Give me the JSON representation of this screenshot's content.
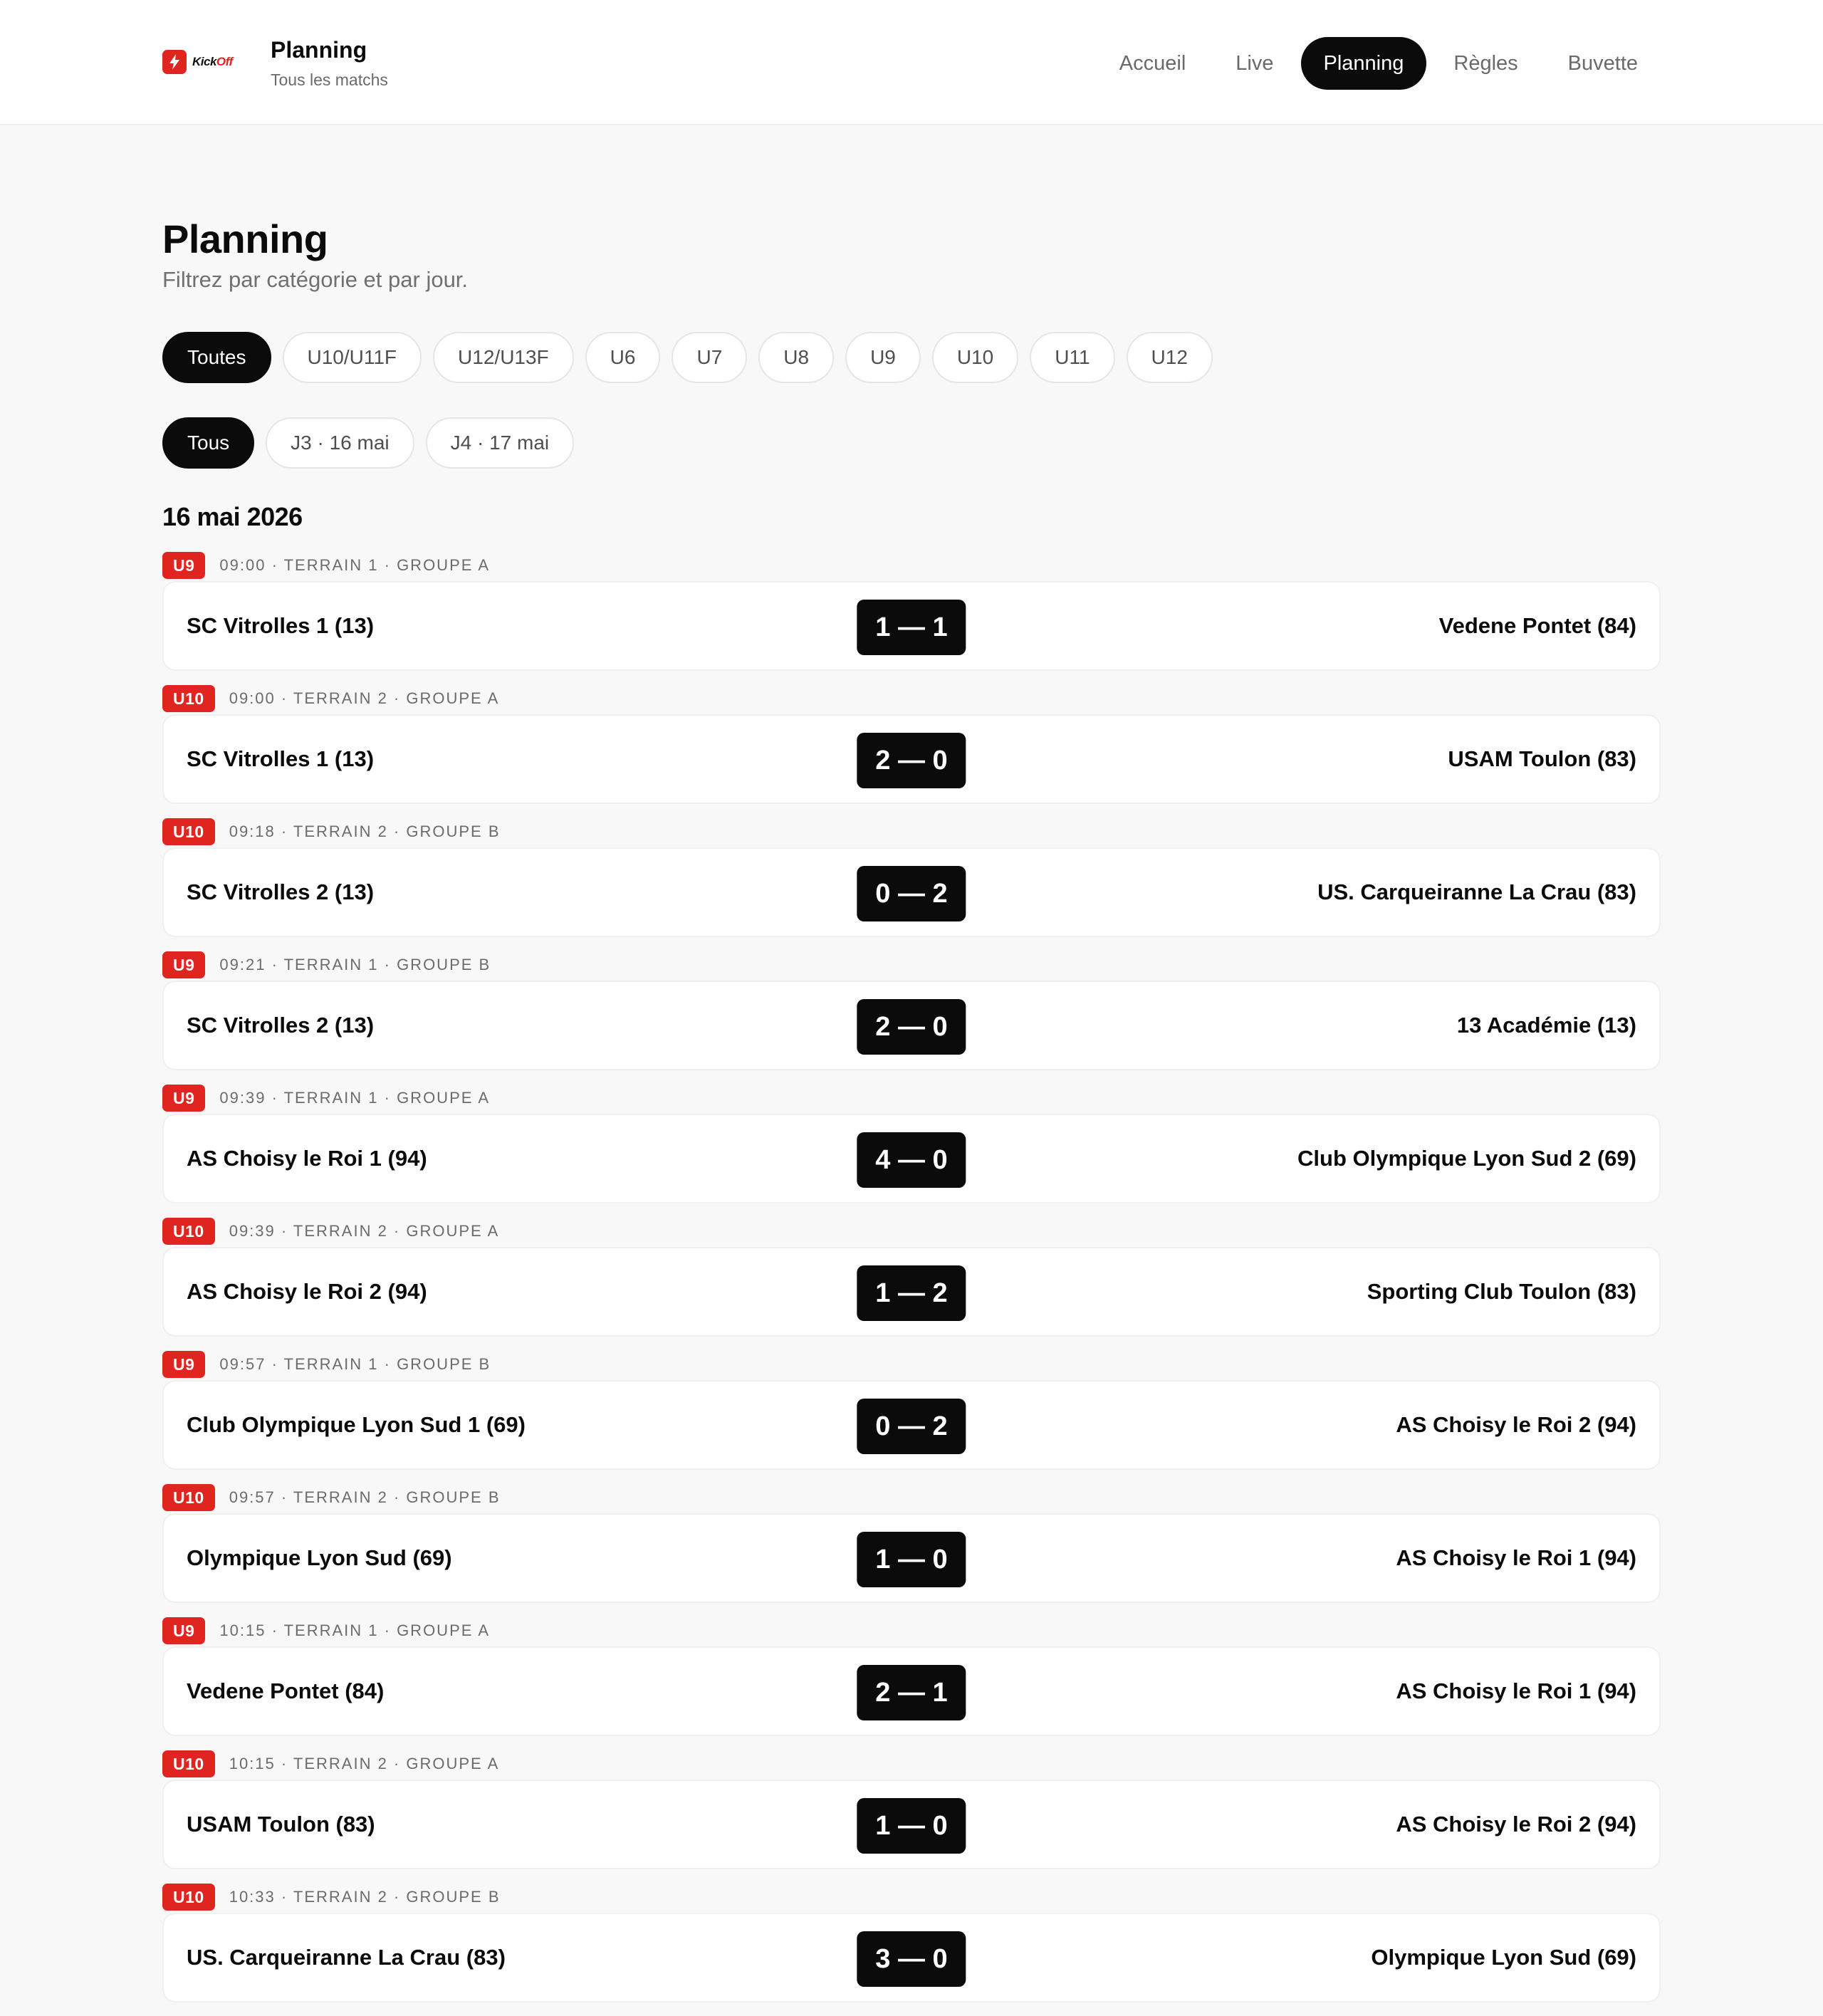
{
  "header": {
    "logo_text_a": "Kick",
    "logo_text_b": "Off",
    "title": "Planning",
    "subtitle": "Tous les matchs",
    "nav": [
      {
        "label": "Accueil",
        "active": false
      },
      {
        "label": "Live",
        "active": false
      },
      {
        "label": "Planning",
        "active": true
      },
      {
        "label": "Règles",
        "active": false
      },
      {
        "label": "Buvette",
        "active": false
      }
    ]
  },
  "page": {
    "title": "Planning",
    "subtitle": "Filtrez par catégorie et par jour."
  },
  "category_filters": [
    {
      "label": "Toutes",
      "active": true
    },
    {
      "label": "U10/U11F",
      "active": false
    },
    {
      "label": "U12/U13F",
      "active": false
    },
    {
      "label": "U6",
      "active": false
    },
    {
      "label": "U7",
      "active": false
    },
    {
      "label": "U8",
      "active": false
    },
    {
      "label": "U9",
      "active": false
    },
    {
      "label": "U10",
      "active": false
    },
    {
      "label": "U11",
      "active": false
    },
    {
      "label": "U12",
      "active": false
    }
  ],
  "day_filters": [
    {
      "label": "Tous",
      "active": true
    },
    {
      "label": "J3 · 16 mai",
      "active": false
    },
    {
      "label": "J4 · 17 mai",
      "active": false
    }
  ],
  "date_heading": "16 mai 2026",
  "colors": {
    "accent": "#e0241f",
    "dark": "#0b0b0b",
    "background": "#f8f8f8"
  },
  "matches": [
    {
      "category": "U9",
      "meta": "09:00 · TERRAIN 1 · GROUPE A",
      "home": "SC Vitrolles 1 (13)",
      "score": "1 — 1",
      "away": "Vedene Pontet (84)"
    },
    {
      "category": "U10",
      "meta": "09:00 · TERRAIN 2 · GROUPE A",
      "home": "SC Vitrolles 1 (13)",
      "score": "2 — 0",
      "away": "USAM Toulon (83)"
    },
    {
      "category": "U10",
      "meta": "09:18 · TERRAIN 2 · GROUPE B",
      "home": "SC Vitrolles 2 (13)",
      "score": "0 — 2",
      "away": "US. Carqueiranne La Crau (83)"
    },
    {
      "category": "U9",
      "meta": "09:21 · TERRAIN 1 · GROUPE B",
      "home": "SC Vitrolles 2 (13)",
      "score": "2 — 0",
      "away": "13 Académie (13)"
    },
    {
      "category": "U9",
      "meta": "09:39 · TERRAIN 1 · GROUPE A",
      "home": "AS Choisy le Roi 1 (94)",
      "score": "4 — 0",
      "away": "Club Olympique Lyon Sud 2 (69)"
    },
    {
      "category": "U10",
      "meta": "09:39 · TERRAIN 2 · GROUPE A",
      "home": "AS Choisy le Roi 2 (94)",
      "score": "1 — 2",
      "away": "Sporting Club Toulon (83)"
    },
    {
      "category": "U9",
      "meta": "09:57 · TERRAIN 1 · GROUPE B",
      "home": "Club Olympique Lyon Sud 1 (69)",
      "score": "0 — 2",
      "away": "AS Choisy le Roi 2 (94)"
    },
    {
      "category": "U10",
      "meta": "09:57 · TERRAIN 2 · GROUPE B",
      "home": "Olympique Lyon Sud (69)",
      "score": "1 — 0",
      "away": "AS Choisy le Roi 1 (94)"
    },
    {
      "category": "U9",
      "meta": "10:15 · TERRAIN 1 · GROUPE A",
      "home": "Vedene Pontet (84)",
      "score": "2 — 1",
      "away": "AS Choisy le Roi 1 (94)"
    },
    {
      "category": "U10",
      "meta": "10:15 · TERRAIN 2 · GROUPE A",
      "home": "USAM Toulon (83)",
      "score": "1 — 0",
      "away": "AS Choisy le Roi 2 (94)"
    },
    {
      "category": "U10",
      "meta": "10:33 · TERRAIN 2 · GROUPE B",
      "home": "US. Carqueiranne La Crau (83)",
      "score": "3 — 0",
      "away": "Olympique Lyon Sud (69)"
    }
  ]
}
